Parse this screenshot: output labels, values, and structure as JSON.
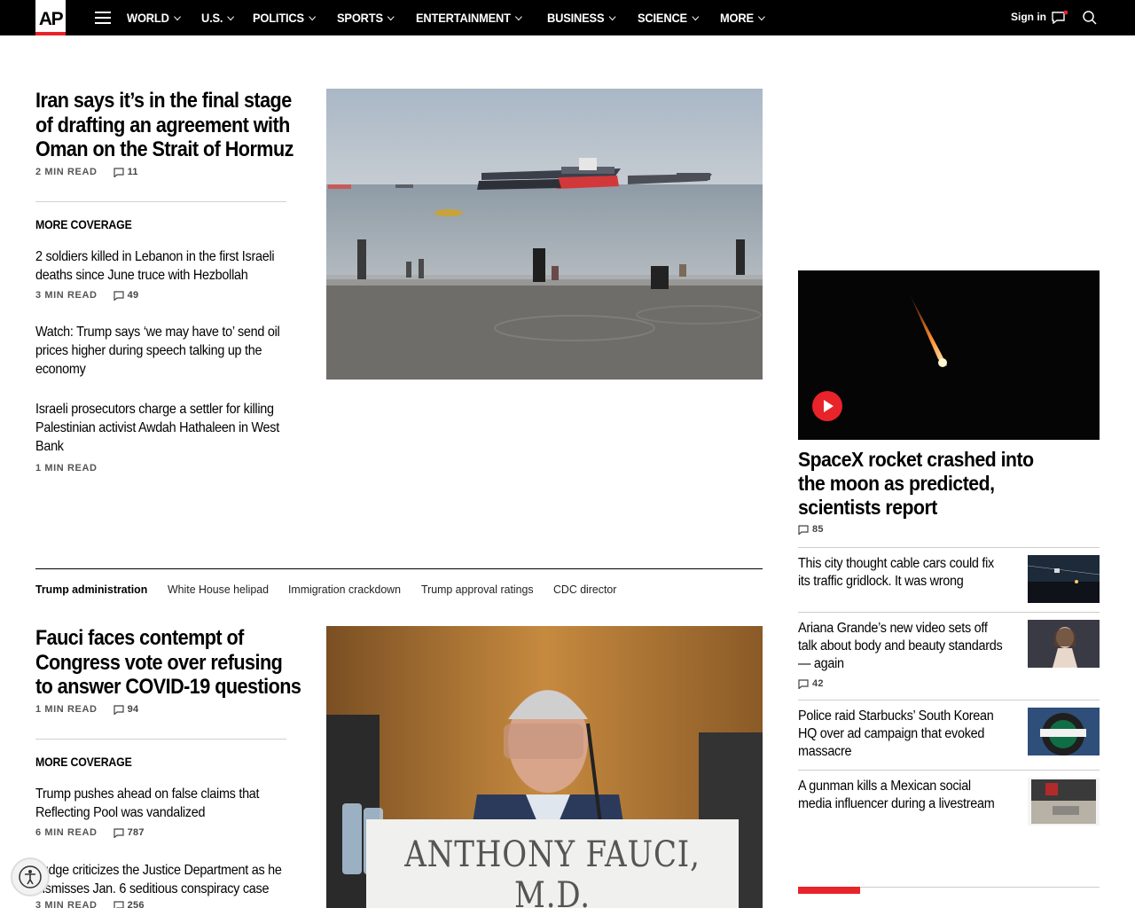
{
  "nav": {
    "logo": "AP",
    "items": [
      {
        "label": "WORLD"
      },
      {
        "label": "U.S."
      },
      {
        "label": "POLITICS"
      },
      {
        "label": "SPORTS"
      },
      {
        "label": "ENTERTAINMENT"
      },
      {
        "label": "BUSINESS"
      },
      {
        "label": "SCIENCE"
      },
      {
        "label": "MORE"
      }
    ],
    "signin": "Sign in"
  },
  "story1": {
    "headline": "Iran says it’s in the final stage of drafting an agreement with Oman on the Strait of Hormuz",
    "read": "2 MIN READ",
    "comments": "11",
    "more_coverage": "MORE COVERAGE",
    "related": [
      {
        "title": "2 soldiers killed in Lebanon in the first Israeli deaths since June truce with Hezbollah",
        "read": "3 MIN READ",
        "comments": "49"
      },
      {
        "title": "Watch: Trump says ‘we may have to’ send oil prices higher during speech talking up the economy"
      },
      {
        "title": "Israeli prosecutors charge a settler for killing Palestinian activist Awdah Hathaleen in West Bank",
        "read": "1 MIN READ"
      }
    ]
  },
  "topics": {
    "items": [
      "Trump administration",
      "White House helipad",
      "Immigration crackdown",
      "Trump approval ratings",
      "CDC director"
    ]
  },
  "story2": {
    "headline": "Fauci faces contempt of Congress vote over refusing to answer COVID-19 questions",
    "read": "1 MIN READ",
    "comments": "94",
    "more_coverage": "MORE COVERAGE",
    "image_placard": "ANTHONY FAUCI, M.D.",
    "related": [
      {
        "title": "Trump pushes ahead on false claims that Reflecting Pool was vandalized",
        "read": "6 MIN READ",
        "comments": "787"
      },
      {
        "title": "Judge criticizes the Justice Department as he dismisses Jan. 6 seditious conspiracy case",
        "read": "3 MIN READ",
        "comments": "256"
      }
    ]
  },
  "right": {
    "video_title": "SpaceX rocket crashed into the moon as predicted, scientists report",
    "video_comments": "85",
    "items": [
      {
        "title": "This city thought cable cars could fix its traffic gridlock. It was wrong"
      },
      {
        "title": "Ariana Grande’s new video sets off talk about body and beauty standards — again",
        "comments": "42"
      },
      {
        "title": "Police raid Starbucks’ South Korean HQ over ad campaign that evoked massacre"
      },
      {
        "title": "A gunman kills a Mexican social media influencer during a livestream"
      }
    ]
  },
  "colors": {
    "accent": "#e8232a",
    "nav_bg": "#000000"
  }
}
